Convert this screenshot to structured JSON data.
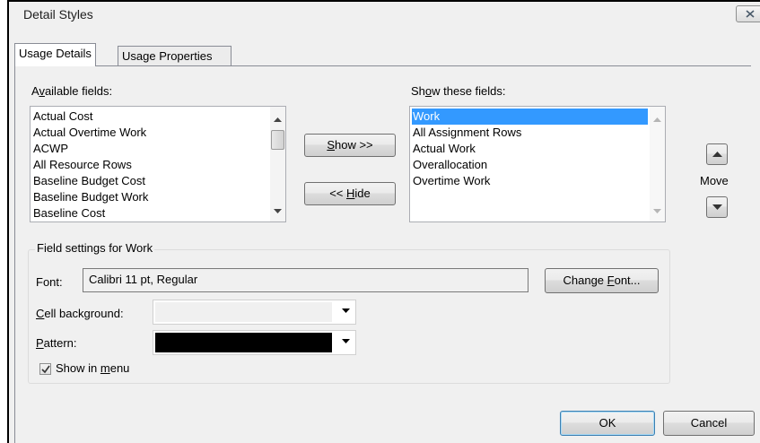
{
  "dialog": {
    "title": "Detail Styles"
  },
  "tabs": [
    {
      "label": "Usage Details",
      "active": true
    },
    {
      "label": "Usage Properties",
      "active": false
    }
  ],
  "available": {
    "label_pre": "A",
    "label_ul": "v",
    "label_post": "ailable fields:",
    "items": [
      "Actual Cost",
      "Actual Overtime Work",
      "ACWP",
      "All Resource Rows",
      "Baseline Budget Cost",
      "Baseline Budget Work",
      "Baseline Cost"
    ]
  },
  "show_fields": {
    "label_pre": "Sh",
    "label_ul": "o",
    "label_post": "w these fields:",
    "items": [
      "Work",
      "All Assignment Rows",
      "Actual Work",
      "Overallocation",
      "Overtime Work"
    ],
    "selected_index": 0
  },
  "buttons": {
    "show_ul": "S",
    "show_post": "how >>",
    "hide_pre": "<< ",
    "hide_ul": "H",
    "hide_post": "ide",
    "move_label": "Move",
    "change_font_pre": "Change ",
    "change_font_ul": "F",
    "change_font_post": "ont...",
    "ok": "OK",
    "cancel": "Cancel"
  },
  "field_settings": {
    "title": "Field settings for Work",
    "font_label": "Font:",
    "font_value": "Calibri 11 pt, Regular",
    "cell_bg_ul": "C",
    "cell_bg_post": "ell background:",
    "cell_bg_color": "#f0f0f0",
    "pattern_ul": "P",
    "pattern_post": "attern:",
    "pattern_color": "#000000",
    "show_in_menu_pre": "Show in ",
    "show_in_menu_ul": "m",
    "show_in_menu_post": "enu",
    "show_in_menu_checked": true
  },
  "colors": {
    "selection": "#3399ff",
    "dialog_bg": "#f0f0f0"
  }
}
